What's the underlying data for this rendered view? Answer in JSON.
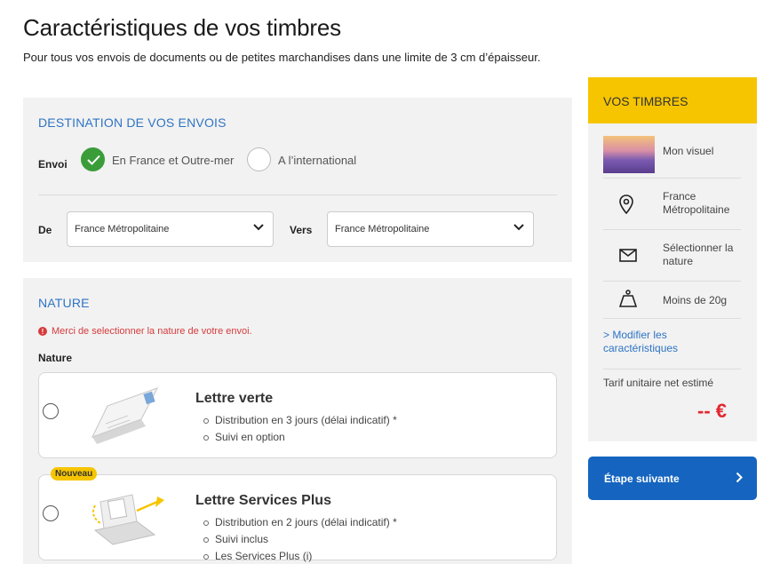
{
  "header": {
    "title": "Caractéristiques de vos timbres",
    "subtitle": "Pour tous vos envois de documents ou de petites marchandises dans une limite de 3 cm d’épaisseur."
  },
  "destination": {
    "section_title": "DESTINATION DE VOS ENVOIS",
    "envoi_label": "Envoi",
    "options": [
      {
        "label": "En France et Outre-mer",
        "selected": true
      },
      {
        "label": "A l’international",
        "selected": false
      }
    ],
    "de_label": "De",
    "de_value": "France Métropolitaine",
    "vers_label": "Vers",
    "vers_value": "France Métropolitaine"
  },
  "nature": {
    "section_title": "NATURE",
    "error": "Merci de selectionner la nature de votre envoi.",
    "label": "Nature",
    "cards": [
      {
        "title": "Lettre verte",
        "badge": "",
        "features": [
          "Distribution en 3 jours (délai indicatif) *",
          "Suivi en option"
        ]
      },
      {
        "title": "Lettre Services Plus",
        "badge": "Nouveau",
        "features": [
          "Distribution en 2 jours (délai indicatif) *",
          "Suivi inclus",
          "Les Services Plus (i)"
        ]
      }
    ]
  },
  "sidebar": {
    "title": "VOS TIMBRES",
    "visuel": "Mon visuel",
    "destination": "France Métropolitaine",
    "nature": "Sélectionner la nature",
    "poids": "Moins de 20g",
    "modify_link": "> Modifier les caractéristiques",
    "tarif_label": "Tarif unitaire net estimé",
    "price": "-- €"
  },
  "next_button": {
    "label": "Étape suivante"
  },
  "colors": {
    "accent_blue": "#2e74c4",
    "yellow": "#f6c500",
    "green_check": "#3a9d3a",
    "error_red": "#d63b3b",
    "price_red": "#e3262e",
    "button_blue": "#1565c0"
  }
}
